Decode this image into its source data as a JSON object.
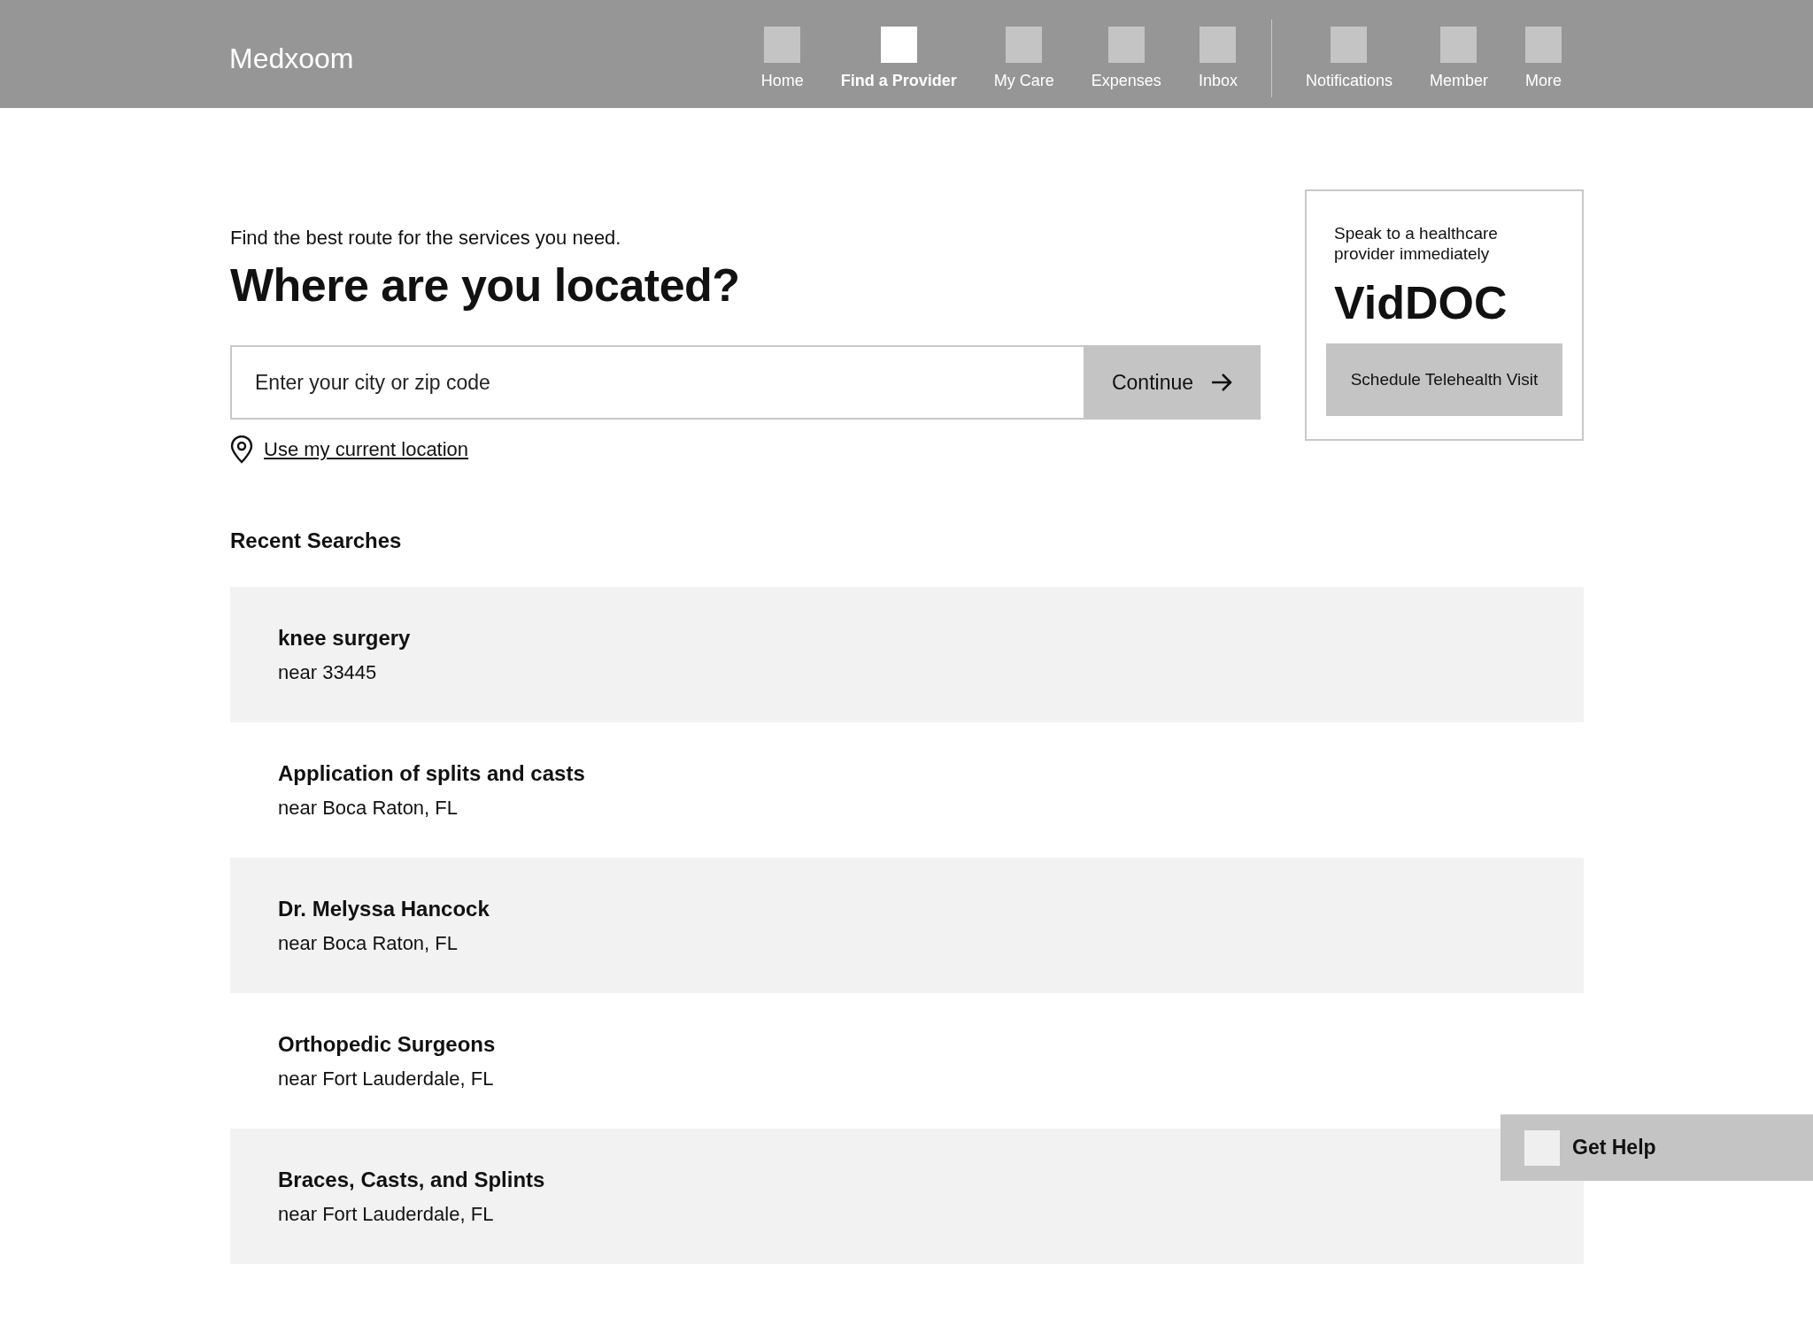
{
  "header": {
    "logo": "Medxoom",
    "nav": [
      {
        "label": "Home",
        "selected": false
      },
      {
        "label": "Find a Provider",
        "selected": true
      },
      {
        "label": "My Care",
        "selected": false
      },
      {
        "label": "Expenses",
        "selected": false
      },
      {
        "label": "Inbox",
        "selected": false
      }
    ],
    "nav_secondary": [
      {
        "label": "Notifications",
        "selected": false
      },
      {
        "label": "Member",
        "selected": false
      },
      {
        "label": "More",
        "selected": false
      }
    ]
  },
  "search": {
    "intro": "Find the best route for the services you need.",
    "heading": "Where are you located?",
    "placeholder": "Enter your city or zip code",
    "button": "Continue",
    "location_link": "Use my current location"
  },
  "promo": {
    "text": "Speak to a healthcare provider immediately",
    "title": "VidDOC",
    "button": "Schedule Telehealth Visit"
  },
  "recent": {
    "title": "Recent Searches",
    "items": [
      {
        "title": "knee surgery",
        "location": "near 33445"
      },
      {
        "title": "Application of splits and casts",
        "location": "near Boca Raton, FL"
      },
      {
        "title": "Dr. Melyssa Hancock",
        "location": "near Boca Raton, FL"
      },
      {
        "title": "Orthopedic Surgeons",
        "location": "near Fort Lauderdale, FL"
      },
      {
        "title": "Braces, Casts, and Splints",
        "location": "near Fort Lauderdale, FL"
      }
    ]
  },
  "help": {
    "label": "Get Help"
  }
}
